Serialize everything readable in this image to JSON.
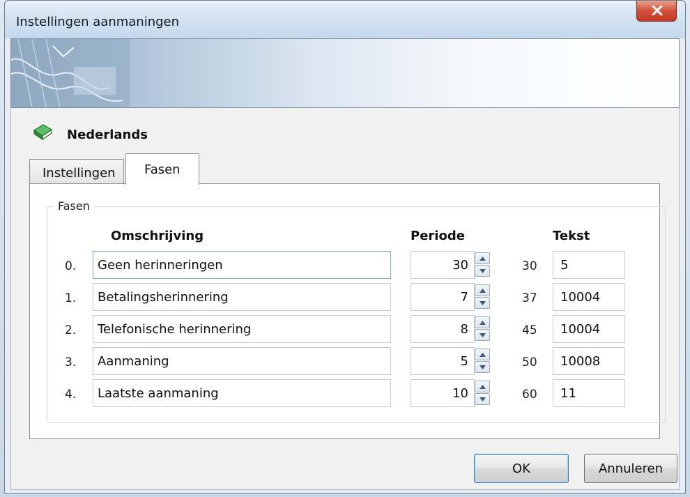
{
  "window": {
    "title": "Instellingen aanmaningen"
  },
  "language": {
    "label": "Nederlands"
  },
  "tabs": [
    {
      "label": "Instellingen",
      "selected": false
    },
    {
      "label": "Fasen",
      "selected": true
    }
  ],
  "fasen": {
    "group_title": "Fasen",
    "headers": {
      "description": "Omschrijving",
      "period": "Periode",
      "text": "Tekst"
    },
    "rows": [
      {
        "num": "0.",
        "description": "Geen herinneringen",
        "period": "30",
        "cumulative": "30",
        "text": "5"
      },
      {
        "num": "1.",
        "description": "Betalingsherinnering",
        "period": "7",
        "cumulative": "37",
        "text": "10004"
      },
      {
        "num": "2.",
        "description": "Telefonische herinnering",
        "period": "8",
        "cumulative": "45",
        "text": "10004"
      },
      {
        "num": "3.",
        "description": "Aanmaning",
        "period": "5",
        "cumulative": "50",
        "text": "10008"
      },
      {
        "num": "4.",
        "description": "Laatste aanmaning",
        "period": "10",
        "cumulative": "60",
        "text": "11"
      }
    ]
  },
  "buttons": {
    "ok": "OK",
    "cancel": "Annuleren"
  },
  "icons": {
    "close": "close-icon",
    "book": "book-icon",
    "spin_up": "arrow-up-icon",
    "spin_down": "arrow-down-icon"
  },
  "colors": {
    "close_button": "#d2503a",
    "book_icon": "#2e8b3a",
    "title_bar": "#cfe0f1"
  }
}
